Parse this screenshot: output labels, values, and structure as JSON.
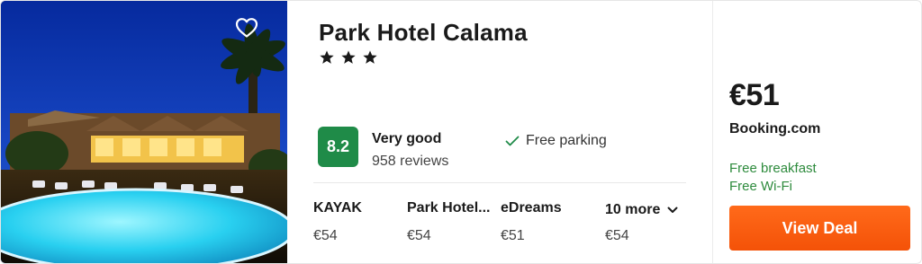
{
  "hotel": {
    "name": "Park Hotel Calama",
    "star_count": 3,
    "score": "8.2",
    "rating_label": "Very good",
    "review_count": "958 reviews",
    "amenity": "Free parking"
  },
  "providers": [
    {
      "name": "KAYAK",
      "price": "€54"
    },
    {
      "name": "Park Hotel...",
      "price": "€54"
    },
    {
      "name": "eDreams",
      "price": "€51"
    },
    {
      "name": "10 more",
      "price": "€54"
    }
  ],
  "deal": {
    "price": "€51",
    "provider": "Booking.com",
    "perks": [
      "Free breakfast",
      "Free Wi-Fi"
    ],
    "button_label": "View Deal"
  },
  "icons": {
    "favorite": "heart-outline-icon",
    "star": "star-icon",
    "check": "check-icon",
    "expand": "chevron-down-icon"
  },
  "colors": {
    "score_badge": "#1f8b48",
    "perk_text": "#2e8b3d",
    "deal_button": "#ff5a14"
  }
}
